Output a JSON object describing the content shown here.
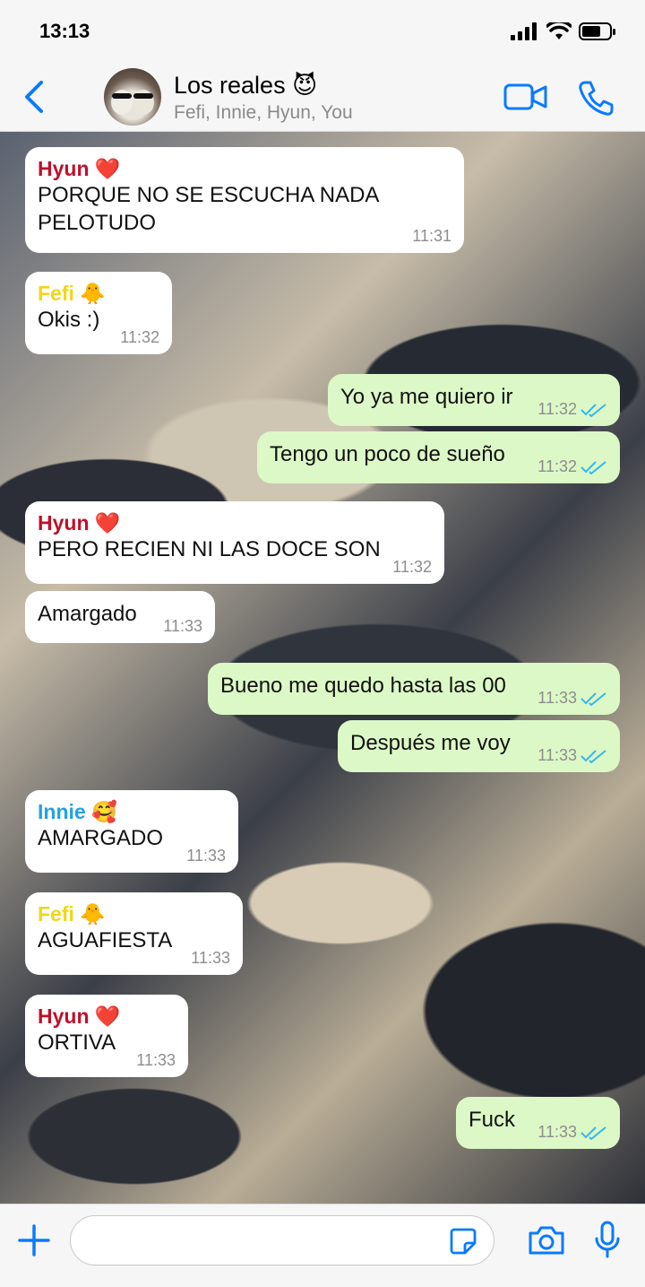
{
  "status": {
    "time": "13:13"
  },
  "header": {
    "title": "Los reales 😈",
    "subtitle": "Fefi, Innie, Hyun, You",
    "icons": [
      "back-chevron-icon",
      "video-call-icon",
      "phone-icon"
    ]
  },
  "colors": {
    "accent": "#0a7aff",
    "tick": "#34b7f1",
    "outgoing": "#dcf8c6",
    "hyun": "#c0102a",
    "fefi": "#f2d61b",
    "innie": "#21a1e8"
  },
  "messages": [
    {
      "dir": "in",
      "sender": "Hyun ❤️",
      "text": "PORQUE NO SE ESCUCHA NADA PELOTUDO",
      "time": "11:31"
    },
    {
      "dir": "in",
      "sender": "Fefi 🐥",
      "text": "Okis :)",
      "time": "11:32"
    },
    {
      "dir": "out",
      "text": "Yo ya me quiero ir",
      "time": "11:32"
    },
    {
      "dir": "out",
      "text": "Tengo un poco de sueño",
      "time": "11:32"
    },
    {
      "dir": "in",
      "sender": "Hyun ❤️",
      "text": "PERO RECIEN NI LAS DOCE SON",
      "time": "11:32"
    },
    {
      "dir": "in",
      "text": "Amargado",
      "time": "11:33"
    },
    {
      "dir": "out",
      "text": "Bueno me quedo hasta las 00",
      "time": "11:33"
    },
    {
      "dir": "out",
      "text": "Después me voy",
      "time": "11:33"
    },
    {
      "dir": "in",
      "sender": "Innie 🥰",
      "text": "AMARGADO",
      "time": "11:33"
    },
    {
      "dir": "in",
      "sender": "Fefi 🐥",
      "text": "AGUAFIESTA",
      "time": "11:33"
    },
    {
      "dir": "in",
      "sender": "Hyun ❤️",
      "text": "ORTIVA",
      "time": "11:33"
    },
    {
      "dir": "out",
      "text": "Fuck",
      "time": "11:33"
    }
  ],
  "composer": {
    "placeholder": "",
    "icons": [
      "plus-icon",
      "sticker-icon",
      "camera-icon",
      "microphone-icon"
    ]
  }
}
